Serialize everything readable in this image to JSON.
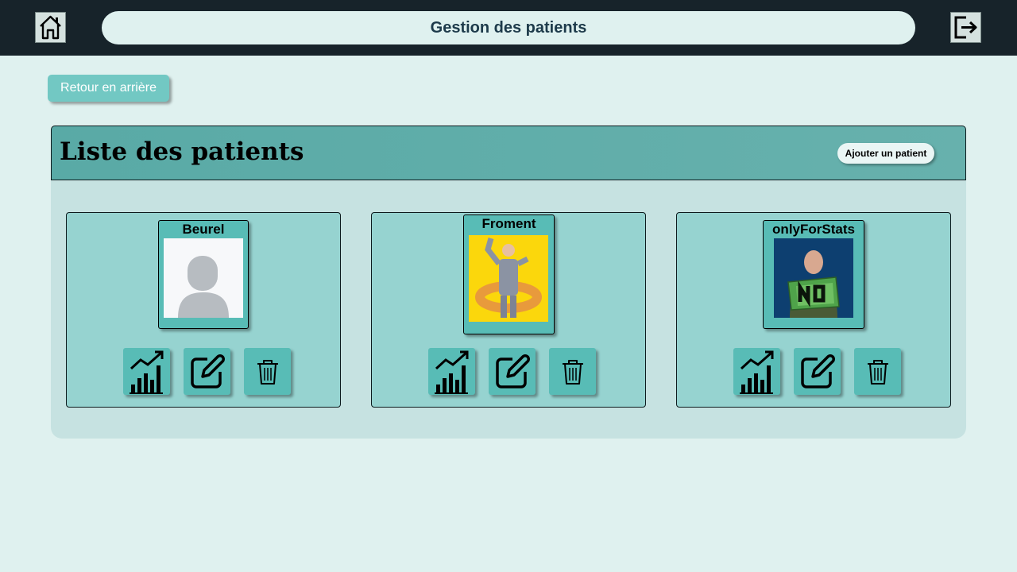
{
  "header": {
    "title": "Gestion des patients",
    "home_icon": "home-icon",
    "logout_icon": "logout-icon"
  },
  "back_button": {
    "label": "Retour en arrière"
  },
  "panel": {
    "title": "Liste des patients",
    "add_button": "Ajouter un patient"
  },
  "patients": [
    {
      "name": "Beurel",
      "photo": "default-avatar"
    },
    {
      "name": "Froment",
      "photo": "man-with-inflatable-ring"
    },
    {
      "name": "onlyForStats",
      "photo": "man-holding-no-sign"
    }
  ],
  "actions": {
    "stats_icon": "chart-trend-icon",
    "edit_icon": "edit-icon",
    "delete_icon": "trash-icon"
  },
  "colors": {
    "topbar": "#17232a",
    "background": "#dff1ef",
    "accent": "#58bcb6",
    "card": "#96d3d0",
    "panel_header": "#5eaba7"
  }
}
